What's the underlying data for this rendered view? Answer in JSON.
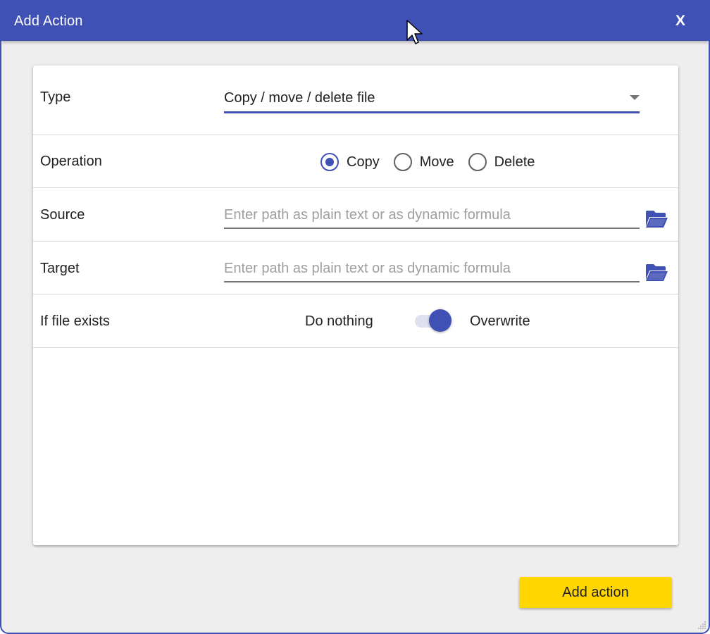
{
  "dialog": {
    "title": "Add Action",
    "close_label": "X"
  },
  "form": {
    "type": {
      "label": "Type",
      "value": "Copy / move / delete file"
    },
    "operation": {
      "label": "Operation",
      "options": [
        "Copy",
        "Move",
        "Delete"
      ],
      "selected": "Copy"
    },
    "source": {
      "label": "Source",
      "value": "",
      "placeholder": "Enter path as plain text or as dynamic formula",
      "icon": "folder-open-icon"
    },
    "target": {
      "label": "Target",
      "value": "",
      "placeholder": "Enter path as plain text or as dynamic formula",
      "icon": "folder-open-icon"
    },
    "if_file_exists": {
      "label": "If file exists",
      "off_label": "Do nothing",
      "on_label": "Overwrite",
      "on": true
    }
  },
  "footer": {
    "add_button_label": "Add action"
  },
  "colors": {
    "primary": "#3f51b5",
    "accent": "#ffd600",
    "background": "#eeeeee"
  }
}
